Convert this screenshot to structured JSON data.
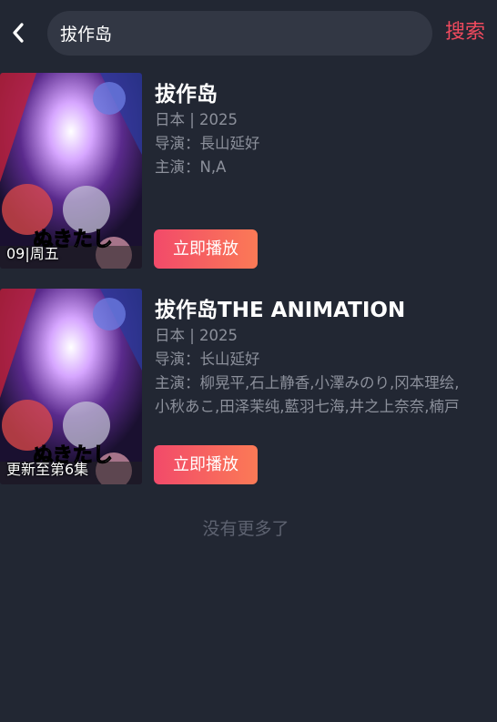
{
  "header": {
    "search_value": "拔作岛",
    "search_label": "搜索",
    "back_icon": "chevron-left-icon"
  },
  "results": [
    {
      "title": "拔作岛",
      "region_year": "日本 | 2025",
      "director": "导演：長山延好",
      "cast_line1": "主演：N,A",
      "cast_line2": "",
      "badge": "09|周五",
      "play_label": "立即播放",
      "poster_text": "ぬきたし"
    },
    {
      "title": "拔作岛THE ANIMATION",
      "region_year": "日本 | 2025",
      "director": "导演：长山延好",
      "cast_line1": "主演：柳晃平,石上静香,小澤みのり,冈本理绘,",
      "cast_line2": "小秋あこ,田泽茉纯,藍羽七海,井之上奈奈,楠戸",
      "badge": "更新至第6集",
      "play_label": "立即播放",
      "poster_text": "ぬきたし"
    }
  ],
  "footer": {
    "no_more": "没有更多了"
  },
  "colors": {
    "background": "#222733",
    "search_bg": "#323744",
    "accent": "#f04a5e",
    "button_gradient_start": "#f24a6a",
    "button_gradient_end": "#fb7a56",
    "meta_text": "#8c909b"
  }
}
